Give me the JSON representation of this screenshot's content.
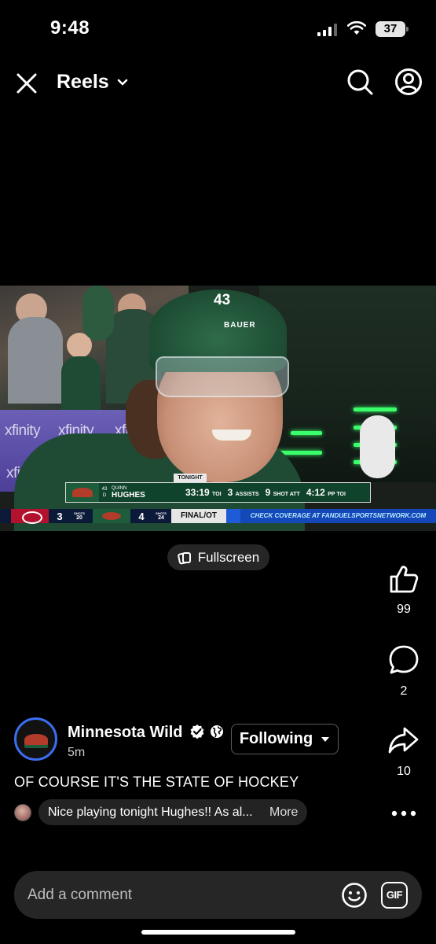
{
  "status_bar": {
    "time": "9:48",
    "battery": "37"
  },
  "header": {
    "title": "Reels"
  },
  "video": {
    "helmet_number": "43",
    "helmet_brand": "BAUER",
    "board_text": "xfinity",
    "lower_third": {
      "tag": "TONIGHT",
      "player_number": "43",
      "player_position": "D",
      "player_first": "QUINN",
      "player_last": "HUGHES",
      "toi": "33:19",
      "toi_label": "TOI",
      "assists": "3",
      "assists_label": "ASSISTS",
      "shot_att": "9",
      "shot_att_label": "SHOT ATT",
      "pp_toi": "4:12",
      "pp_toi_label": "PP TOI"
    },
    "scoreboard": {
      "away_score": "3",
      "away_shots_label": "SHOTS",
      "away_shots": "20",
      "home_score": "4",
      "home_shots_label": "SHOTS",
      "home_shots": "24",
      "status": "FINAL/OT",
      "ticker": "CHECK COVERAGE AT FANDUELSPORTSNETWORK.COM"
    }
  },
  "fullscreen": {
    "label": "Fullscreen"
  },
  "rail": {
    "likes": "99",
    "comments": "2",
    "shares": "10"
  },
  "author": {
    "name": "Minnesota Wild",
    "time": "5m",
    "follow_label": "Following"
  },
  "caption": "OF COURSE IT'S THE STATE OF HOCKEY",
  "top_comment": {
    "text": "Nice playing tonight Hughes!! As al...",
    "more": "More"
  },
  "add_comment": {
    "placeholder": "Add a comment"
  },
  "icons": {
    "close": "close-icon",
    "chevron": "chevron-down-icon",
    "search": "search-icon",
    "profile": "profile-icon",
    "like": "thumbs-up-icon",
    "comment": "comment-icon",
    "share": "share-icon",
    "more": "more-icon",
    "emoji": "emoji-icon",
    "gif": "gif-icon"
  },
  "colors": {
    "background": "#000000",
    "avatar_ring": "#3b6ef2",
    "pill": "#262626"
  }
}
